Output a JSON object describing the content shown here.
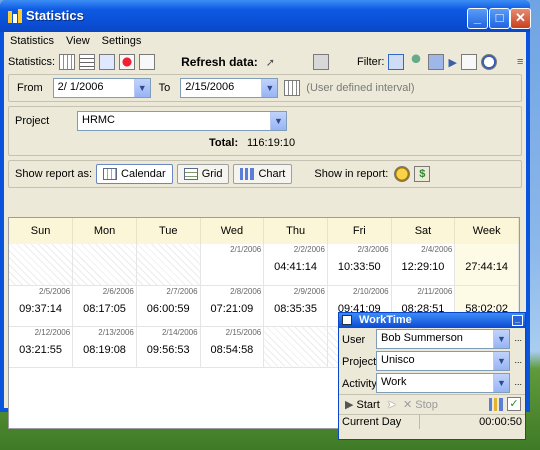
{
  "window": {
    "title": "Statistics"
  },
  "menu": [
    "Statistics",
    "View",
    "Settings"
  ],
  "toolbar": {
    "statistics_label": "Statistics:",
    "refresh_label": "Refresh data:",
    "filter_label": "Filter:"
  },
  "dates": {
    "from_label": "From",
    "from_value": "2/ 1/2006",
    "to_label": "To",
    "to_value": "2/15/2006",
    "interval_note": "(User defined interval)"
  },
  "project": {
    "label": "Project",
    "value": "HRMC",
    "total_label": "Total:",
    "total_value": "116:19:10"
  },
  "show": {
    "report_as_label": "Show report as:",
    "calendar_label": "Calendar",
    "grid_label": "Grid",
    "chart_label": "Chart",
    "in_report_label": "Show in report:"
  },
  "calendar": {
    "headers": [
      "Sun",
      "Mon",
      "Tue",
      "Wed",
      "Thu",
      "Fri",
      "Sat",
      "Week"
    ],
    "rows": [
      [
        {
          "date": "",
          "value": ""
        },
        {
          "date": "",
          "value": ""
        },
        {
          "date": "",
          "value": ""
        },
        {
          "date": "2/1/2006",
          "value": ""
        },
        {
          "date": "2/2/2006",
          "value": "04:41:14"
        },
        {
          "date": "2/3/2006",
          "value": "10:33:50"
        },
        {
          "date": "2/4/2006",
          "value": "12:29:10"
        },
        {
          "date": "",
          "value": "27:44:14"
        }
      ],
      [
        {
          "date": "2/5/2006",
          "value": "09:37:14"
        },
        {
          "date": "2/6/2006",
          "value": "08:17:05"
        },
        {
          "date": "2/7/2006",
          "value": "06:00:59"
        },
        {
          "date": "2/8/2006",
          "value": "07:21:09"
        },
        {
          "date": "2/9/2006",
          "value": "08:35:35"
        },
        {
          "date": "2/10/2006",
          "value": "09:41:09"
        },
        {
          "date": "2/11/2006",
          "value": "08:28:51"
        },
        {
          "date": "",
          "value": "58:02:02"
        }
      ],
      [
        {
          "date": "2/12/2006",
          "value": "03:21:55"
        },
        {
          "date": "2/13/2006",
          "value": "08:19:08"
        },
        {
          "date": "2/14/2006",
          "value": "09:56:53"
        },
        {
          "date": "2/15/2006",
          "value": "08:54:58"
        },
        {
          "date": "",
          "value": ""
        },
        {
          "date": "",
          "value": ""
        },
        {
          "date": "",
          "value": ""
        },
        {
          "date": "",
          "value": ""
        }
      ]
    ]
  },
  "worktime": {
    "title": "WorkTime",
    "user_label": "User",
    "user_value": "Bob Summerson",
    "project_label": "Project",
    "project_value": "Unisco",
    "activity_label": "Activity",
    "activity_value": "Work",
    "more": "...",
    "start_label": "Start",
    "stop_label": "Stop",
    "status_label": "Current Day",
    "status_value": "00:00:50"
  }
}
